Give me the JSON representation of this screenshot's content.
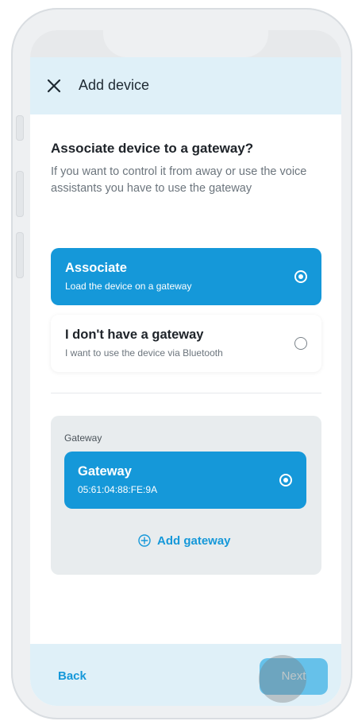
{
  "header": {
    "title": "Add device",
    "close_icon": "close-icon"
  },
  "question": {
    "title": "Associate device to a gateway?",
    "hint": "If you want to control it from away or use the voice assistants you have to use the gateway"
  },
  "options": [
    {
      "title": "Associate",
      "subtitle": "Load the device on a gateway",
      "selected": true
    },
    {
      "title": "I don't have a gateway",
      "subtitle": "I want to use the device via Bluetooth",
      "selected": false
    }
  ],
  "gateway_section": {
    "label": "Gateway",
    "gateways": [
      {
        "name": "Gateway",
        "mac": "05:61:04:88:FE:9A",
        "selected": true
      }
    ],
    "add_label": "Add gateway",
    "add_icon": "plus-circle-icon"
  },
  "footer": {
    "back_label": "Back",
    "next_label": "Next"
  },
  "colors": {
    "accent": "#1598d9",
    "header_bg": "#dff0f8",
    "panel_bg": "#e8ecee",
    "next_button_bg": "#66c1ea"
  }
}
